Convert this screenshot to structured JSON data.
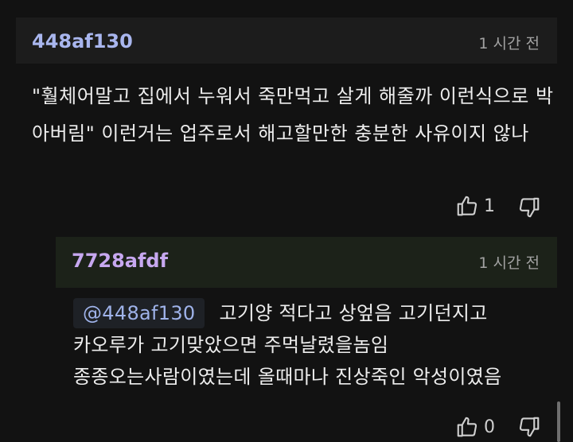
{
  "comment": {
    "author": "448af130",
    "time": "1 시간 전",
    "body": "\"훨체어말고 집에서 누워서 죽만먹고 살게 해줄까 이런식으로 박아버림\" 이런거는 업주로서 해고할만한 충분한 사유이지 않나",
    "like_count": "1"
  },
  "reply": {
    "author": "7728afdf",
    "time": "1 시간 전",
    "mention": "@448af130",
    "line1": "고기양 적다고 상엎음 고기던지고",
    "line2": "카오루가 고기맞았으면 주먹날렸을놈임",
    "line3": "종종오는사람이였는데 올때마나 진상죽인 악성이였음",
    "like_count": "0"
  },
  "icons": {
    "like": "thumbs-up-icon",
    "dislike": "thumbs-down-icon"
  },
  "colors": {
    "background": "#121212",
    "comment_header": "#1c1c1c",
    "reply_header": "#1c2219",
    "author1": "#a9b6ee",
    "author2": "#c7a8f0"
  }
}
